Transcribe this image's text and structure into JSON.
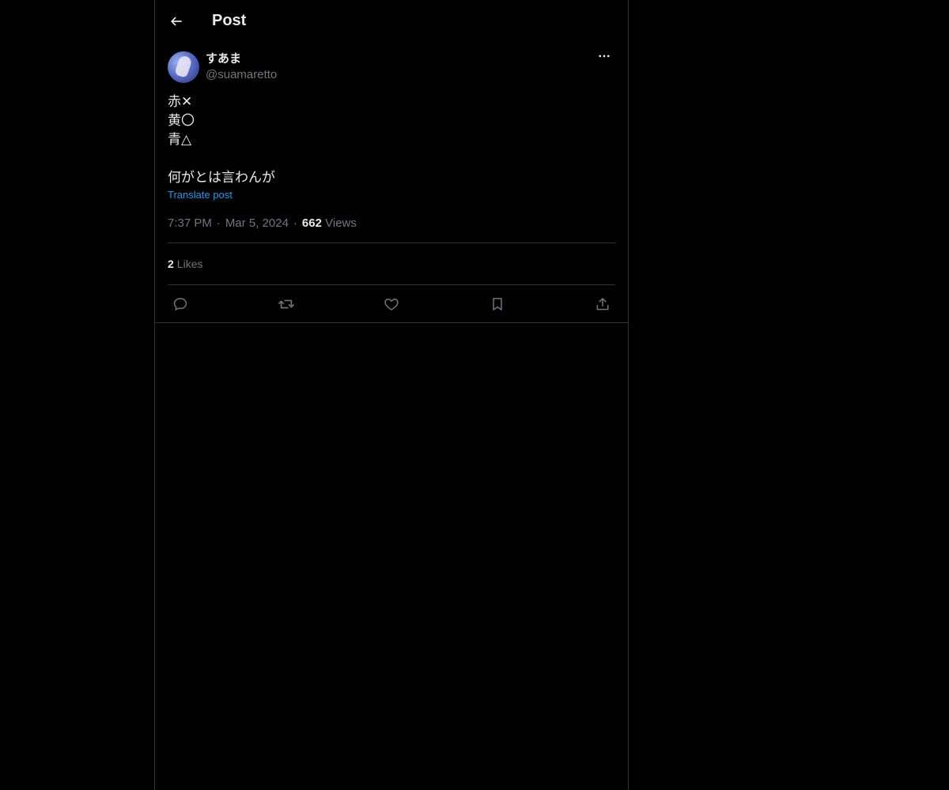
{
  "header": {
    "title": "Post",
    "back_icon": "arrow-left-icon"
  },
  "post": {
    "author": {
      "display_name": "すあま",
      "handle": "@suamaretto"
    },
    "text": "赤✕\n黄〇\n青△\n\n何がとは言わんが",
    "translate_label": "Translate post",
    "time": "7:37 PM",
    "date": "Mar 5, 2024",
    "views_count": "662",
    "views_label": "Views",
    "likes_count": "2",
    "likes_label": "Likes"
  },
  "icons": {
    "more": "more-horizontal-icon",
    "reply": "reply-icon",
    "repost": "repost-icon",
    "like": "heart-icon",
    "bookmark": "bookmark-icon",
    "share": "share-icon"
  },
  "colors": {
    "background": "#000000",
    "text": "#e7e9ea",
    "secondary": "#71767b",
    "accent": "#1d9bf0",
    "border": "#2f3336"
  }
}
